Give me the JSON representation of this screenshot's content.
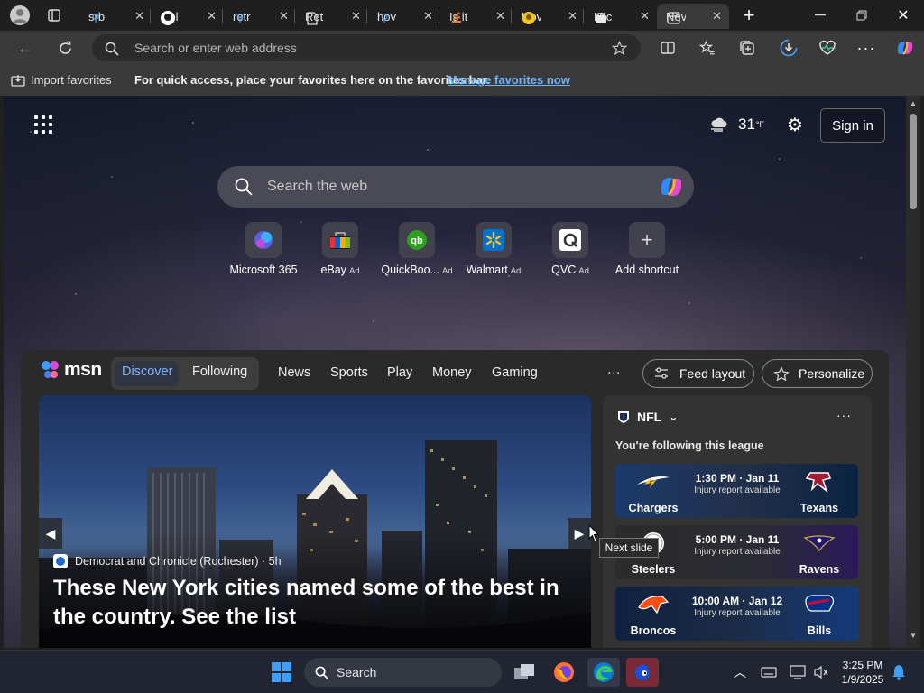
{
  "browser": {
    "tabs": [
      {
        "label": "srb",
        "icon": "search-icon"
      },
      {
        "label": "Rel",
        "icon": "github-icon"
      },
      {
        "label": "retr",
        "icon": "search-icon"
      },
      {
        "label": "Ret",
        "icon": "document-icon"
      },
      {
        "label": "hov",
        "icon": "search-icon"
      },
      {
        "label": "Is it",
        "icon": "stackoverflow-icon"
      },
      {
        "label": "Hov",
        "icon": "bulb-icon"
      },
      {
        "label": "Mic",
        "icon": "bag-icon"
      },
      {
        "label": "Nev",
        "icon": "newtab-icon",
        "active": true
      }
    ],
    "address_placeholder": "Search or enter web address"
  },
  "favorites_bar": {
    "import_label": "Import favorites",
    "message": "For quick access, place your favorites here on the favorites bar.",
    "manage_link": "Manage favorites now"
  },
  "newtab": {
    "weather": {
      "temp": "31",
      "unit": "°F"
    },
    "sign_in": "Sign in",
    "search_placeholder": "Search the web",
    "shortcuts": [
      {
        "label": "Microsoft 365",
        "ad": ""
      },
      {
        "label": "eBay",
        "ad": "Ad"
      },
      {
        "label": "QuickBoo...",
        "ad": "Ad"
      },
      {
        "label": "Walmart",
        "ad": "Ad"
      },
      {
        "label": "QVC",
        "ad": "Ad"
      },
      {
        "label": "Add shortcut",
        "ad": ""
      }
    ]
  },
  "feed": {
    "brand": "msn",
    "tabs": {
      "discover": "Discover",
      "following": "Following",
      "news": "News",
      "sports": "Sports",
      "play": "Play",
      "money": "Money",
      "gaming": "Gaming",
      "more": "···"
    },
    "feed_layout": "Feed layout",
    "personalize": "Personalize",
    "hero": {
      "source": "Democrat and Chronicle (Rochester)",
      "age": "· 5h",
      "headline": "These New York cities named some of the best in the country. See the list",
      "tooltip": "Next slide"
    },
    "nfl": {
      "title": "NFL",
      "subtitle": "You're following this league",
      "games": [
        {
          "home": "Chargers",
          "away": "Texans",
          "time": "1:30 PM · Jan 11",
          "note": "Injury report available",
          "home_color": "#1a3a6b",
          "away_color": "#0a2342"
        },
        {
          "home": "Steelers",
          "away": "Ravens",
          "time": "5:00 PM · Jan 11",
          "note": "Injury report available",
          "home_color": "#2b2b2b",
          "away_color": "#2a1a5a"
        },
        {
          "home": "Broncos",
          "away": "Bills",
          "time": "10:00 AM · Jan 12",
          "note": "Injury report available",
          "home_color": "#10213f",
          "away_color": "#143a7a"
        }
      ]
    }
  },
  "taskbar": {
    "search_placeholder": "Search",
    "time": "3:25 PM",
    "date": "1/9/2025"
  }
}
